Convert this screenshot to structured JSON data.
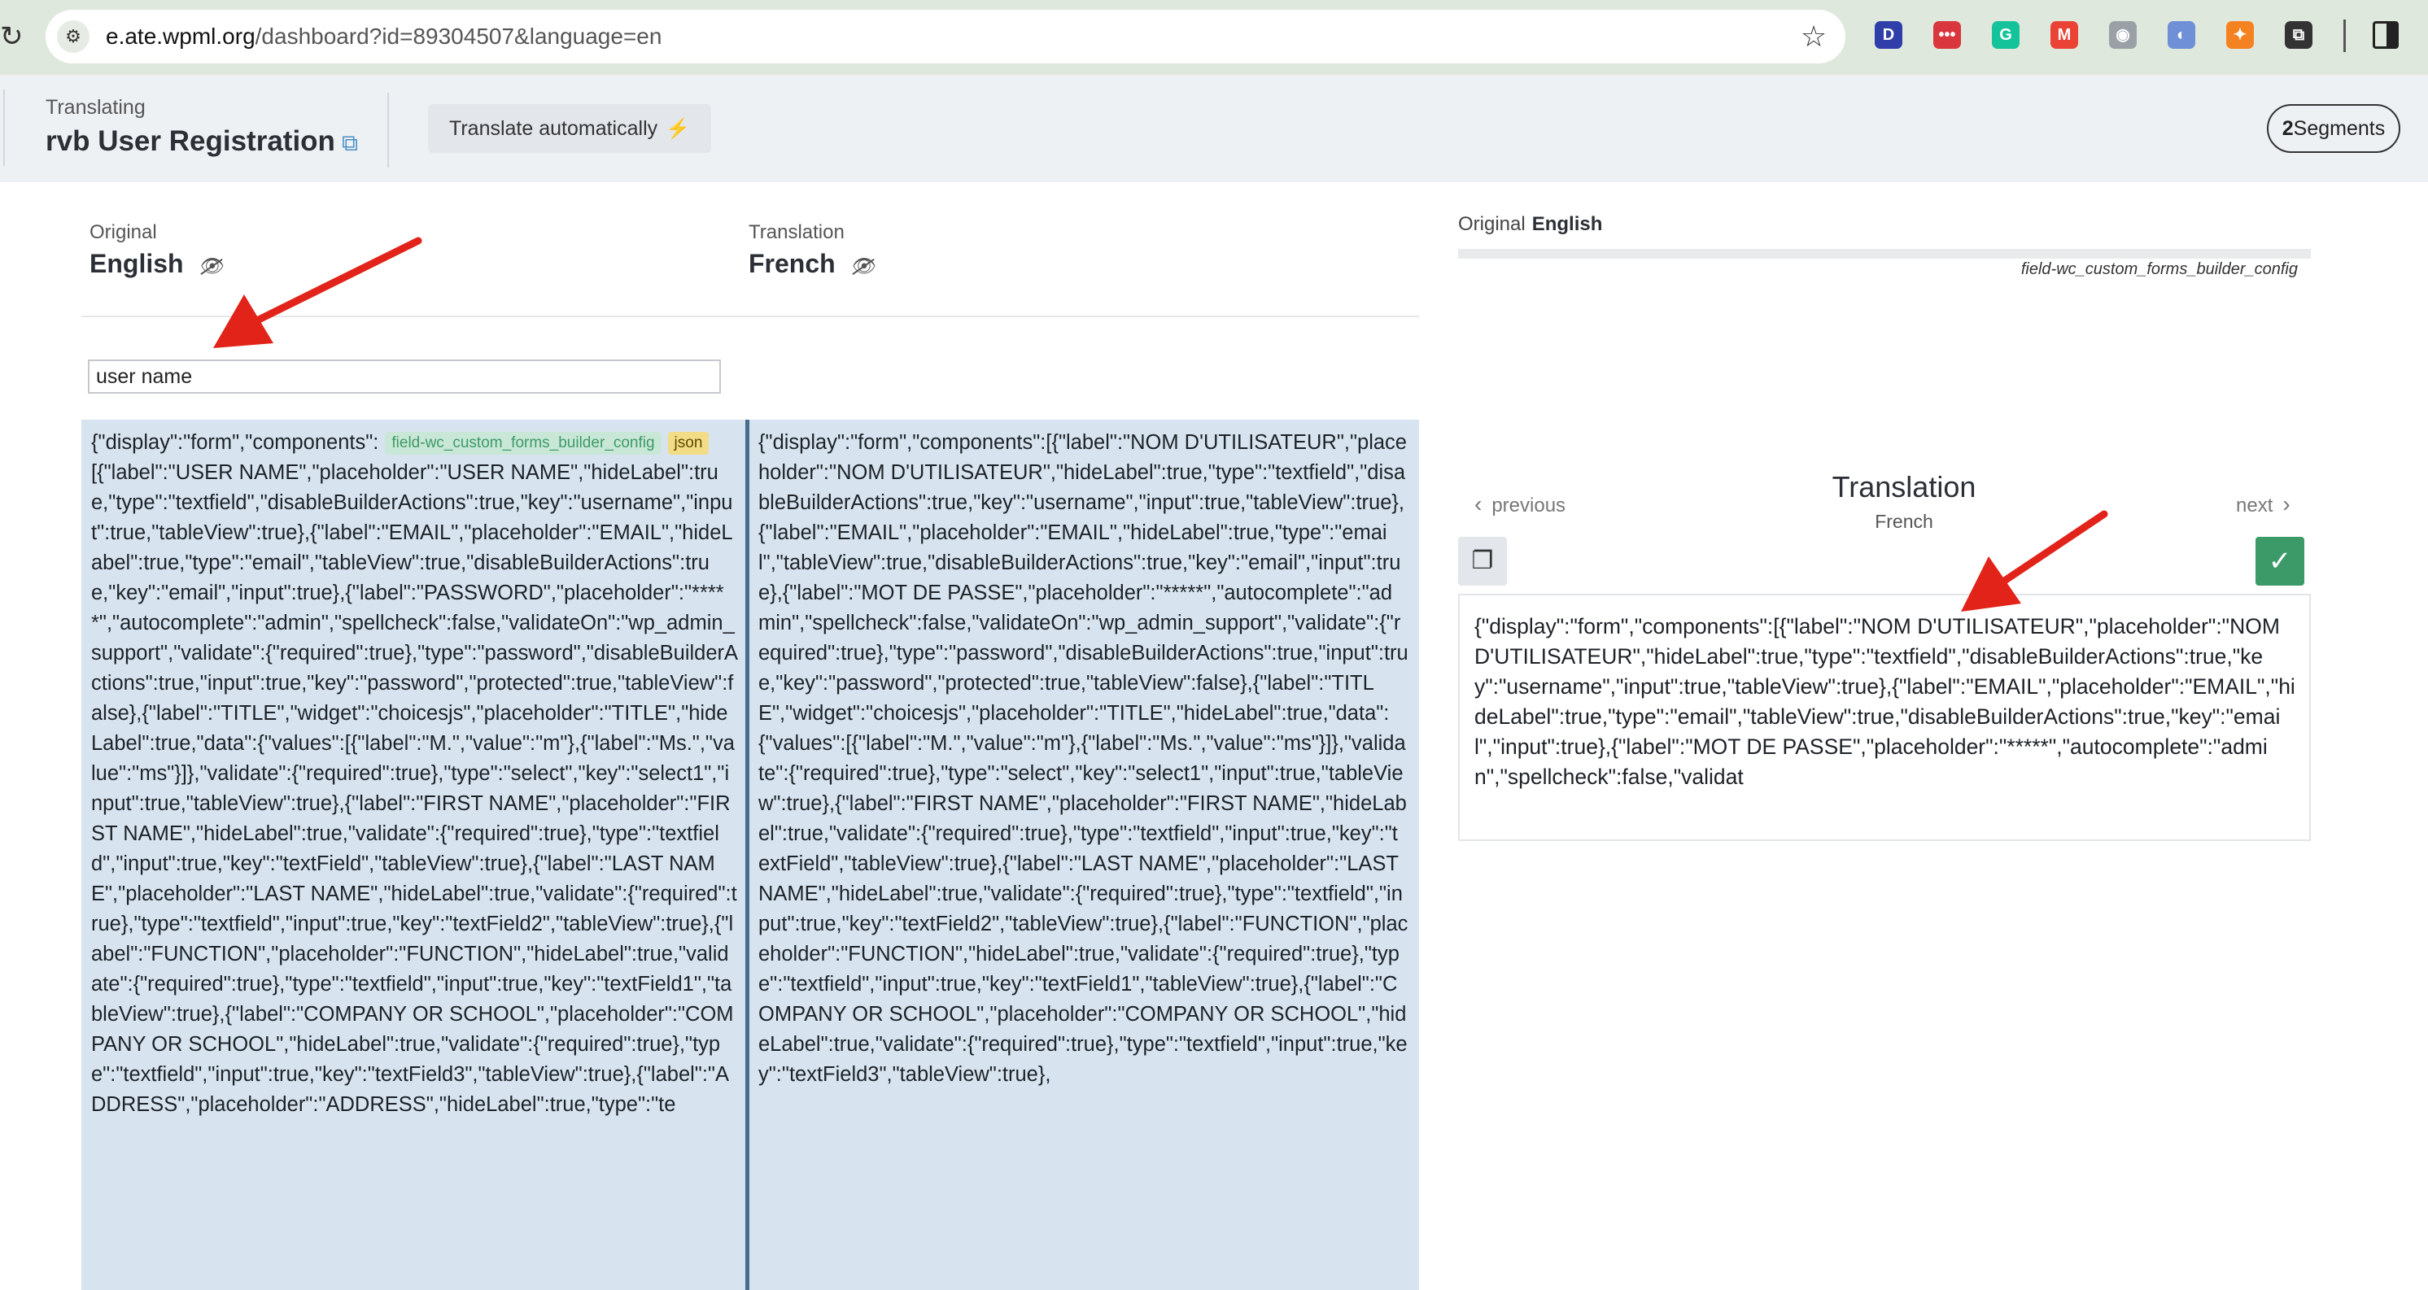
{
  "browser": {
    "url_host": "e.ate.wpml.org",
    "url_path": "/dashboard?id=89304507&language=en",
    "extensions": [
      {
        "name": "d-extension-icon",
        "label": "D",
        "color": "#2f3ea8"
      },
      {
        "name": "dots-extension-icon",
        "label": "•••",
        "color": "#d9363e"
      },
      {
        "name": "grammarly-extension-icon",
        "label": "G",
        "color": "#15c39a"
      },
      {
        "name": "gmail-extension-icon",
        "label": "M",
        "color": "#ea4335"
      },
      {
        "name": "camera-extension-icon",
        "label": "◉",
        "color": "#9aa0a6"
      },
      {
        "name": "swirl-extension-icon",
        "label": "◐",
        "color": "#6f8fd6"
      },
      {
        "name": "orange-extension-icon",
        "label": "✦",
        "color": "#f58220"
      },
      {
        "name": "puzzle-extension-icon",
        "label": "⧉",
        "color": "#333333"
      }
    ]
  },
  "header": {
    "translating_label": "Translating",
    "project_title": "rvb User Registration",
    "translate_auto_label": "Translate automatically",
    "segments_count": "2",
    "segments_label": "Segments"
  },
  "columns": {
    "original_label": "Original",
    "original_lang": "English",
    "translation_label": "Translation",
    "translation_lang": "French"
  },
  "filter": {
    "value": "user name"
  },
  "segment": {
    "field_tag": "field-wc_custom_forms_builder_config",
    "type_tag": "json",
    "original_text": "{\"display\":\"form\",\"components\":[{\"label\":\"USER NAME\",\"placeholder\":\"USER NAME\",\"hideLabel\":true,\"type\":\"textfield\",\"disableBuilderActions\":true,\"key\":\"username\",\"input\":true,\"tableView\":true},{\"label\":\"EMAIL\",\"placeholder\":\"EMAIL\",\"hideLabel\":true,\"type\":\"email\",\"tableView\":true,\"disableBuilderActions\":true,\"key\":\"email\",\"input\":true},{\"label\":\"PASSWORD\",\"placeholder\":\"*****\",\"autocomplete\":\"admin\",\"spellcheck\":false,\"validateOn\":\"wp_admin_support\",\"validate\":{\"required\":true},\"type\":\"password\",\"disableBuilderActions\":true,\"input\":true,\"key\":\"password\",\"protected\":true,\"tableView\":false},{\"label\":\"TITLE\",\"widget\":\"choicesjs\",\"placeholder\":\"TITLE\",\"hideLabel\":true,\"data\":{\"values\":[{\"label\":\"M.\",\"value\":\"m\"},{\"label\":\"Ms.\",\"value\":\"ms\"}]},\"validate\":{\"required\":true},\"type\":\"select\",\"key\":\"select1\",\"input\":true,\"tableView\":true},{\"label\":\"FIRST NAME\",\"placeholder\":\"FIRST NAME\",\"hideLabel\":true,\"validate\":{\"required\":true},\"type\":\"textfield\",\"input\":true,\"key\":\"textField\",\"tableView\":true},{\"label\":\"LAST NAME\",\"placeholder\":\"LAST NAME\",\"hideLabel\":true,\"validate\":{\"required\":true},\"type\":\"textfield\",\"input\":true,\"key\":\"textField2\",\"tableView\":true},{\"label\":\"FUNCTION\",\"placeholder\":\"FUNCTION\",\"hideLabel\":true,\"validate\":{\"required\":true},\"type\":\"textfield\",\"input\":true,\"key\":\"textField1\",\"tableView\":true},{\"label\":\"COMPANY OR SCHOOL\",\"placeholder\":\"COMPANY OR SCHOOL\",\"hideLabel\":true,\"validate\":{\"required\":true},\"type\":\"textfield\",\"input\":true,\"key\":\"textField3\",\"tableView\":true},{\"label\":\"ADDRESS\",\"placeholder\":\"ADDRESS\",\"hideLabel\":true,\"type\":\"te",
    "translation_text": "{\"display\":\"form\",\"components\":[{\"label\":\"NOM D'UTILISATEUR\",\"placeholder\":\"NOM D'UTILISATEUR\",\"hideLabel\":true,\"type\":\"textfield\",\"disableBuilderActions\":true,\"key\":\"username\",\"input\":true,\"tableView\":true},{\"label\":\"EMAIL\",\"placeholder\":\"EMAIL\",\"hideLabel\":true,\"type\":\"email\",\"tableView\":true,\"disableBuilderActions\":true,\"key\":\"email\",\"input\":true},{\"label\":\"MOT DE PASSE\",\"placeholder\":\"*****\",\"autocomplete\":\"admin\",\"spellcheck\":false,\"validateOn\":\"wp_admin_support\",\"validate\":{\"required\":true},\"type\":\"password\",\"disableBuilderActions\":true,\"input\":true,\"key\":\"password\",\"protected\":true,\"tableView\":false},{\"label\":\"TITLE\",\"widget\":\"choicesjs\",\"placeholder\":\"TITLE\",\"hideLabel\":true,\"data\":{\"values\":[{\"label\":\"M.\",\"value\":\"m\"},{\"label\":\"Ms.\",\"value\":\"ms\"}]},\"validate\":{\"required\":true},\"type\":\"select\",\"key\":\"select1\",\"input\":true,\"tableView\":true},{\"label\":\"FIRST NAME\",\"placeholder\":\"FIRST NAME\",\"hideLabel\":true,\"validate\":{\"required\":true},\"type\":\"textfield\",\"input\":true,\"key\":\"textField\",\"tableView\":true},{\"label\":\"LAST NAME\",\"placeholder\":\"LAST NAME\",\"hideLabel\":true,\"validate\":{\"required\":true},\"type\":\"textfield\",\"input\":true,\"key\":\"textField2\",\"tableView\":true},{\"label\":\"FUNCTION\",\"placeholder\":\"FUNCTION\",\"hideLabel\":true,\"validate\":{\"required\":true},\"type\":\"textfield\",\"input\":true,\"key\":\"textField1\",\"tableView\":true},{\"label\":\"COMPANY OR SCHOOL\",\"placeholder\":\"COMPANY OR SCHOOL\",\"hideLabel\":true,\"validate\":{\"required\":true},\"type\":\"textfield\",\"input\":true,\"key\":\"textField3\",\"tableView\":true},"
  },
  "right_panel": {
    "original_label": "Original",
    "original_lang": "English",
    "field_name": "field-wc_custom_forms_builder_config",
    "previous_label": "previous",
    "next_label": "next",
    "title": "Translation",
    "lang": "French",
    "editor_text": "{\"display\":\"form\",\"components\":[{\"label\":\"NOM D'UTILISATEUR\",\"placeholder\":\"NOM D'UTILISATEUR\",\"hideLabel\":true,\"type\":\"textfield\",\"disableBuilderActions\":true,\"key\":\"username\",\"input\":true,\"tableView\":true},{\"label\":\"EMAIL\",\"placeholder\":\"EMAIL\",\"hideLabel\":true,\"type\":\"email\",\"tableView\":true,\"disableBuilderActions\":true,\"key\":\"email\",\"input\":true},{\"label\":\"MOT DE PASSE\",\"placeholder\":\"*****\",\"autocomplete\":\"admin\",\"spellcheck\":false,\"validat"
  },
  "colors": {
    "accent_green": "#3c9a69",
    "segment_bg": "#d7e4ef",
    "segment_divider": "#486d8e",
    "annotation_red": "#e2231a"
  }
}
